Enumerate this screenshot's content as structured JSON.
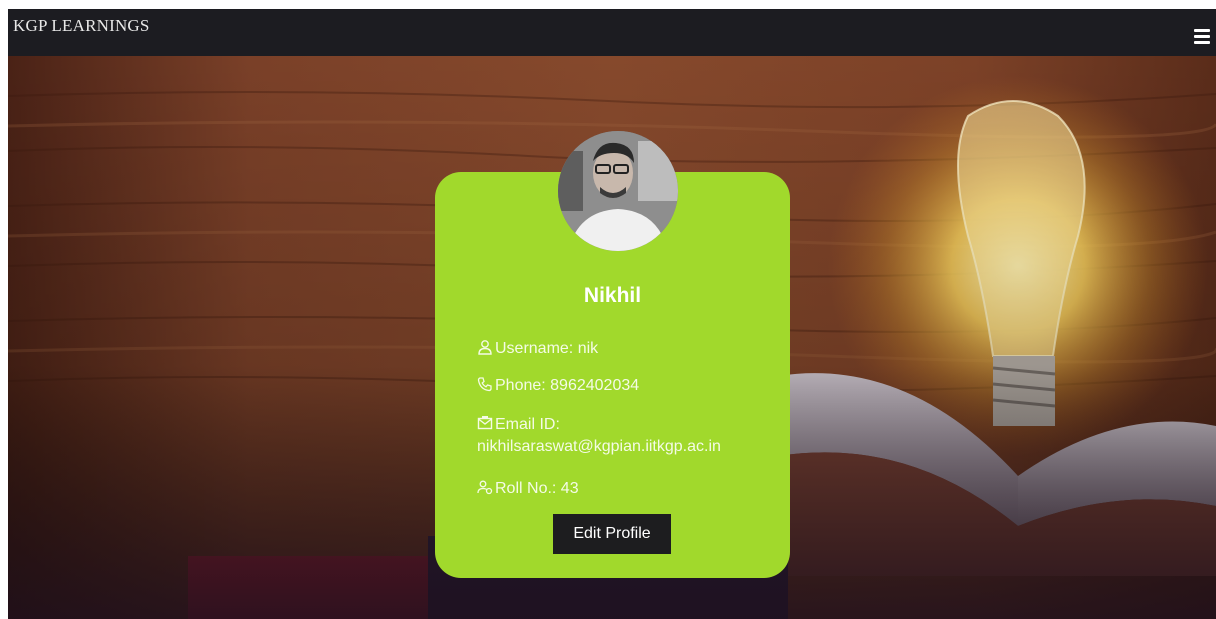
{
  "navbar": {
    "brand": "KGP LEARNINGS",
    "menu_icon": "hamburger-menu-icon"
  },
  "profile": {
    "name": "Nikhil",
    "username_label": "Username: nik",
    "phone_label": "Phone: 8962402034",
    "email_label": "Email ID:",
    "email_value": "nikhilsaraswat@kgpian.iitkgp.ac.in",
    "roll_label": "Roll No.: 43",
    "edit_button": "Edit Profile",
    "icons": {
      "username": "user-icon",
      "phone": "phone-icon",
      "email": "email-icon",
      "roll": "users-icon"
    }
  },
  "colors": {
    "navbar_bg": "#1c1c21",
    "card_bg": "#a1d92c",
    "button_bg": "#1d1d1f",
    "text": "#ffffff"
  }
}
